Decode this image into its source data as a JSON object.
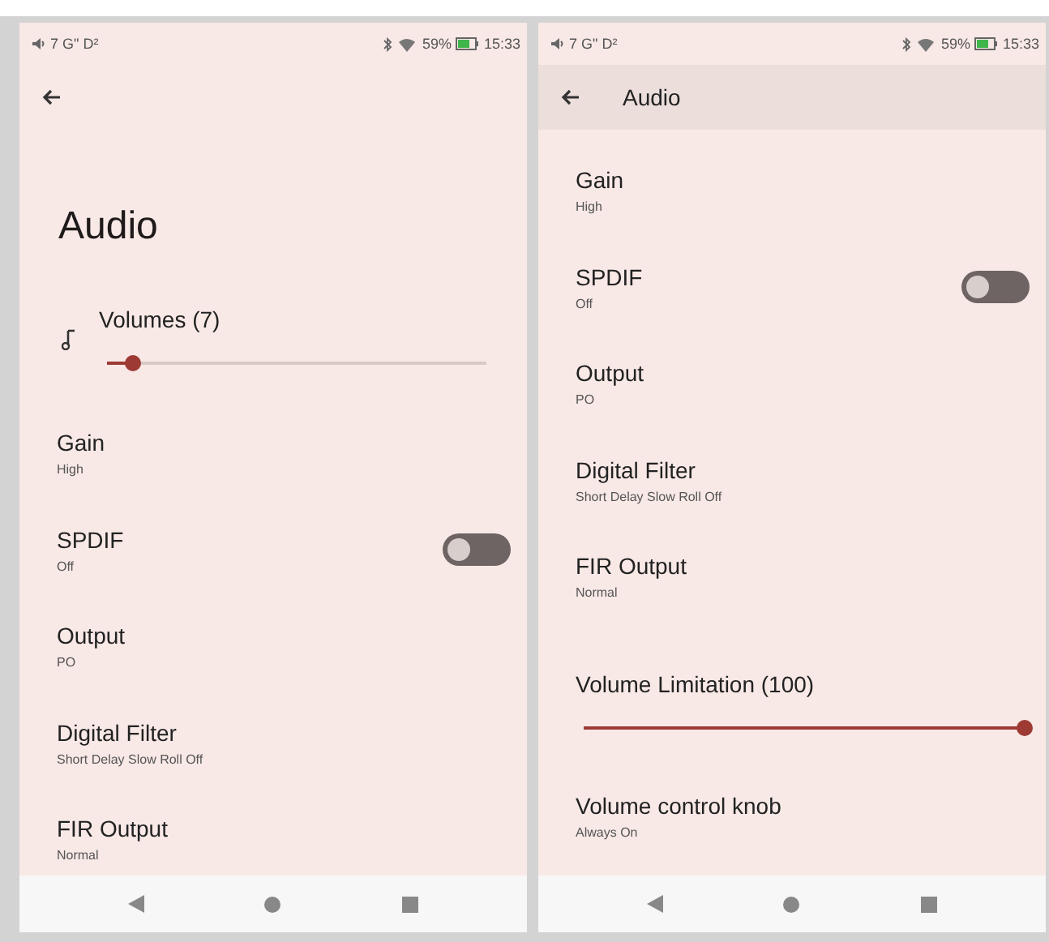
{
  "screens": [
    {
      "status_bar": {
        "left": "7 G\" D²",
        "battery": "59%",
        "time": "15:33"
      },
      "header": {
        "kind": "large",
        "title": "Audio"
      },
      "items": [
        {
          "kind": "slider",
          "title": "Volumes (7)",
          "level": 0.07,
          "icon": true
        },
        {
          "kind": "setting",
          "title": "Gain",
          "value": "High"
        },
        {
          "kind": "toggle",
          "title": "SPDIF",
          "value": "Off",
          "on": false
        },
        {
          "kind": "setting",
          "title": "Output",
          "value": "PO"
        },
        {
          "kind": "setting",
          "title": "Digital Filter",
          "value": "Short Delay Slow Roll Off"
        },
        {
          "kind": "setting",
          "title": "FIR Output",
          "value": "Normal"
        }
      ]
    },
    {
      "status_bar": {
        "left": "7 G\" D²",
        "battery": "59%",
        "time": "15:33"
      },
      "header": {
        "kind": "toolbar",
        "title": "Audio"
      },
      "items": [
        {
          "kind": "setting",
          "title": "Gain",
          "value": "High"
        },
        {
          "kind": "toggle",
          "title": "SPDIF",
          "value": "Off",
          "on": false
        },
        {
          "kind": "setting",
          "title": "Output",
          "value": "PO"
        },
        {
          "kind": "setting",
          "title": "Digital Filter",
          "value": "Short Delay Slow Roll Off"
        },
        {
          "kind": "setting",
          "title": "FIR Output",
          "value": "Normal"
        },
        {
          "kind": "slider",
          "title": "Volume Limitation (100)",
          "level": 1,
          "icon": false
        },
        {
          "kind": "setting",
          "title": "Volume control knob",
          "value": "Always On"
        }
      ]
    }
  ]
}
